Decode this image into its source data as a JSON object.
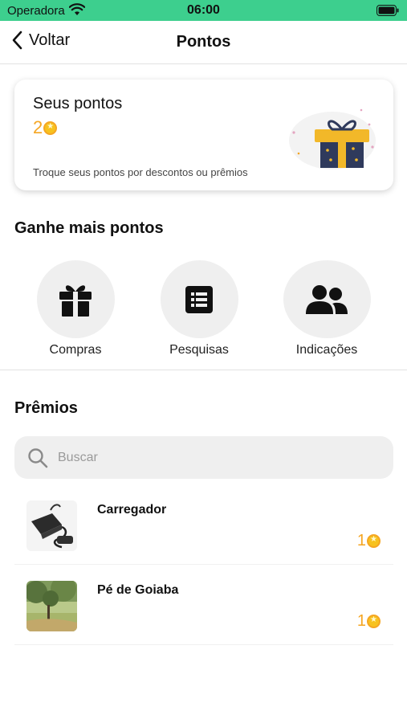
{
  "status_bar": {
    "carrier": "Operadora",
    "time": "06:00"
  },
  "nav": {
    "back_label": "Voltar",
    "title": "Pontos"
  },
  "points_card": {
    "title": "Seus pontos",
    "value": "2",
    "hint": "Troque seus pontos por descontos ou prêmios"
  },
  "earn": {
    "title": "Ganhe mais pontos",
    "items": [
      {
        "label": "Compras",
        "icon": "gift-icon"
      },
      {
        "label": "Pesquisas",
        "icon": "list-icon"
      },
      {
        "label": "Indicações",
        "icon": "users-icon"
      }
    ]
  },
  "prizes": {
    "title": "Prêmios",
    "search_placeholder": "Buscar",
    "items": [
      {
        "name": "Carregador",
        "price": "1"
      },
      {
        "name": "Pé de Goiaba",
        "price": "1"
      }
    ]
  },
  "colors": {
    "status_bar": "#3dcf8e",
    "points": "#f5a623",
    "circle_bg": "#efefef"
  }
}
